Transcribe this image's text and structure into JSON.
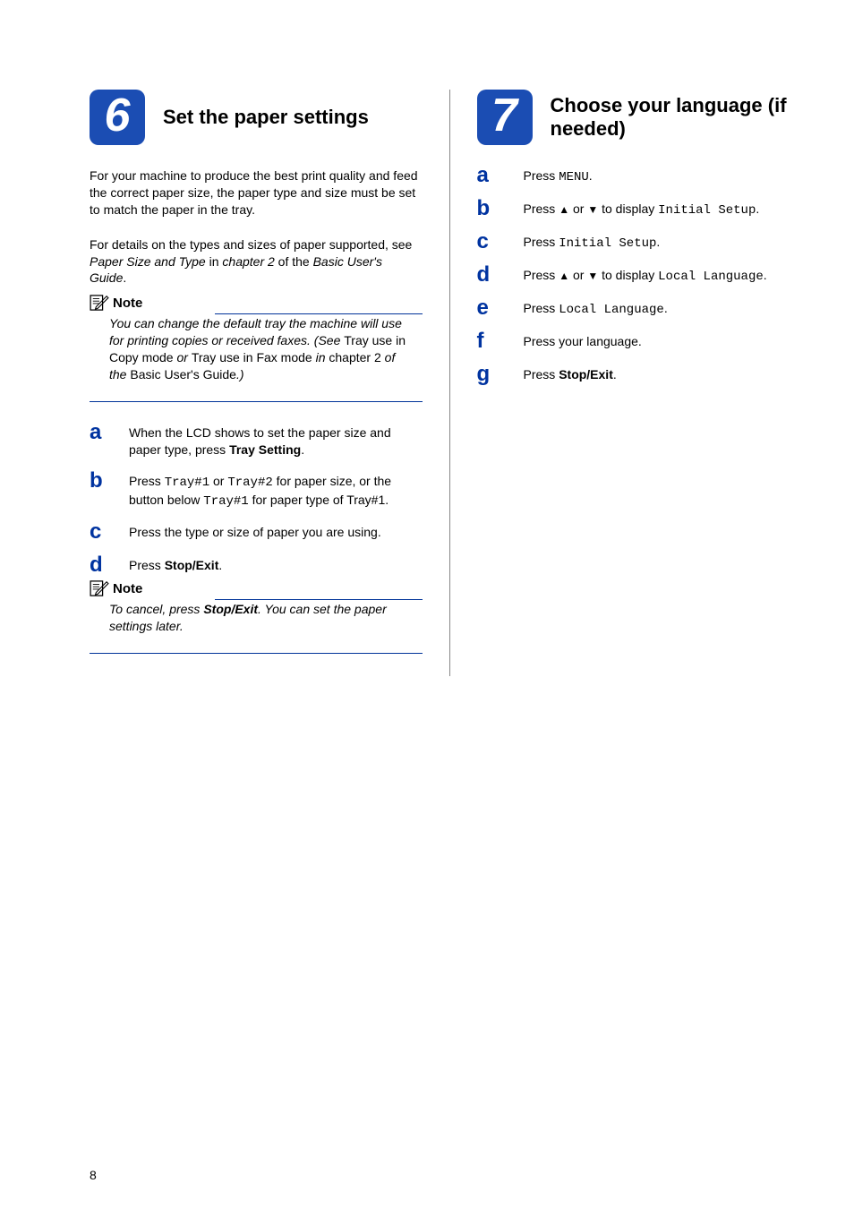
{
  "page_number": "8",
  "left": {
    "step_number": "6",
    "title": "Set the paper settings",
    "intro_1": "For your machine to produce the best print quality and feed the correct paper size, the paper type and size must be set to match the paper in the tray.",
    "intro_2a": "For details on the types and sizes of paper supported, see ",
    "intro_2_ref1": "Paper Size and Type",
    "intro_2b": " in ",
    "intro_2_ref2": "chapter 2",
    "intro_2c": " of the ",
    "intro_2_ref3": "Basic User's Guide",
    "intro_2d": ".",
    "note1_label": "Note",
    "note1_a": "You can change the default tray the machine will use for printing copies or received faxes. (See ",
    "note1_b": "Tray use in Copy mode",
    "note1_c": " or ",
    "note1_d": "Tray use in Fax mode",
    "note1_e": " in ",
    "note1_f": "chapter 2",
    "note1_g": " of the ",
    "note1_h": "Basic User's Guide",
    "note1_i": ".)",
    "steps": {
      "a_1": "When the LCD shows to set the paper size and paper type, press ",
      "a_bold": "Tray Setting",
      "a_2": ".",
      "b_1": "Press ",
      "b_m1": "Tray#1",
      "b_2": " or ",
      "b_m2": "Tray#2",
      "b_3": " for paper size, or the button below ",
      "b_m3": "Tray#1",
      "b_4": " for paper type of Tray#1.",
      "c": "Press the type or size of paper you are using.",
      "d_1": "Press ",
      "d_bold": "Stop/Exit",
      "d_2": "."
    },
    "note2_label": "Note",
    "note2_a": "To cancel, press ",
    "note2_bold": "Stop/Exit",
    "note2_b": ". You can set the paper settings later."
  },
  "right": {
    "step_number": "7",
    "title": "Choose your language (if needed)",
    "steps": {
      "a_1": "Press ",
      "a_m": "MENU",
      "a_2": ".",
      "b_1": "Press ",
      "b_arrow1": "▲",
      "b_2": " or ",
      "b_arrow2": "▼",
      "b_3": " to display ",
      "b_m": "Initial Setup",
      "b_4": ".",
      "c_1": "Press ",
      "c_m": "Initial Setup",
      "c_2": ".",
      "d_1": "Press ",
      "d_arrow1": "▲",
      "d_2": " or ",
      "d_arrow2": "▼",
      "d_3": " to display ",
      "d_m": "Local Language",
      "d_4": ".",
      "e_1": "Press ",
      "e_m": "Local Language",
      "e_2": ".",
      "f": "Press your language.",
      "g_1": "Press ",
      "g_bold": "Stop/Exit",
      "g_2": "."
    }
  }
}
